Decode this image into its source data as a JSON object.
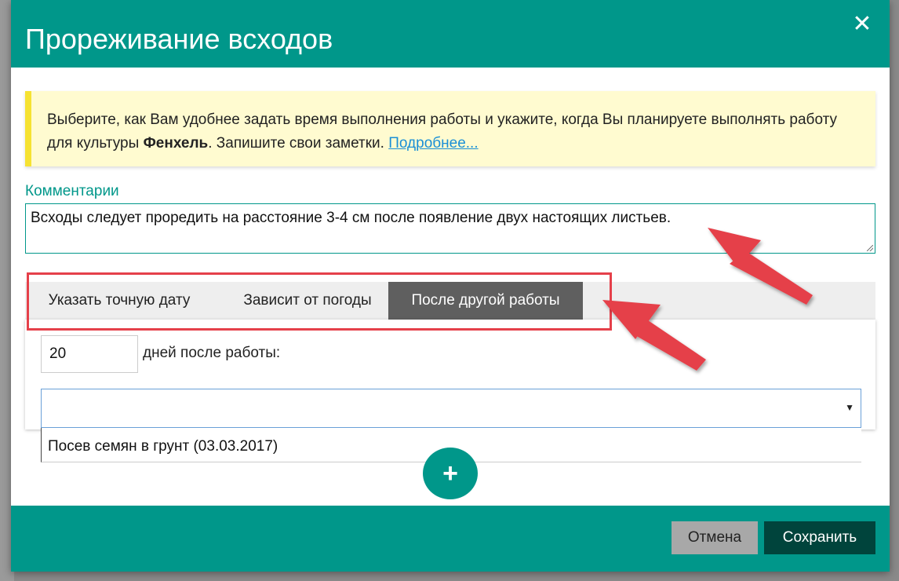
{
  "dialog": {
    "title": "Прореживание всходов",
    "close_symbol": "✕"
  },
  "info": {
    "text_before": "Выберите, как Вам удобнее задать время выполнения работы и укажите, когда Вы планируете выполнять работу для культуры ",
    "crop_name": "Фенхель",
    "text_after": ". Запишите свои заметки. ",
    "more_link": "Подробнее..."
  },
  "comments": {
    "label": "Комментарии",
    "value": "Всходы следует проредить на расстояние 3-4 см после появление двух настоящих листьев."
  },
  "tabs": [
    {
      "label": "Указать точную дату",
      "active": false
    },
    {
      "label": "Зависит от погоды",
      "active": false
    },
    {
      "label": "После другой работы",
      "active": true
    }
  ],
  "after_work": {
    "days_value": "20",
    "days_label": "дней после работы:",
    "select_value": "",
    "select_arrow": "▼",
    "options": [
      "Посев семян в грунт (03.03.2017)"
    ]
  },
  "add_button": {
    "symbol": "+",
    "icon": "plus-icon"
  },
  "footer": {
    "cancel_label": "Отмена",
    "save_label": "Сохранить"
  },
  "colors": {
    "primary": "#00978a",
    "dark_primary": "#00443c",
    "highlight": "#e5404a",
    "notice_bg": "#fffbd0",
    "notice_border": "#f6e232"
  }
}
